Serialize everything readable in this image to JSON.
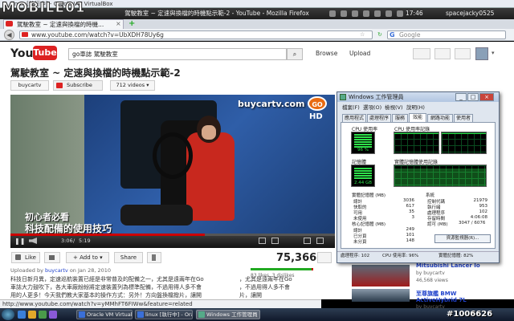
{
  "vm": {
    "title": "linux [執行中] - Oracle VM VirtualBox",
    "logo": "MOBILE01"
  },
  "panel": {
    "firefox_title": "駕駛教室 ~ 定速與換檔的時機點示範-2 - YouTube - Mozilla Firefox",
    "clock": "17:46",
    "user": "spacejacky0525"
  },
  "browser": {
    "tab_label": "駕駛教室 ~ 定速與換檔的時機...",
    "new_tab": "+",
    "url": "www.youtube.com/watch?v=UbXDH78Uy6g",
    "search_placeholder": "Google",
    "status_url": "http://www.youtube.com/watch?v=yMMhFT6FIWw&feature=related"
  },
  "youtube": {
    "logo_you": "You",
    "logo_tube": "Tube",
    "search_value": "go車誌 駕駛教室",
    "browse": "Browse",
    "upload": "Upload",
    "video_title": "駕駛教室 ~ 定速與換檔的時機點示範-2",
    "channel": "buycartv",
    "subscribe": "Subscribe",
    "videos": "712 videos ▾",
    "overlay_brand": "buycartv.com",
    "overlay_badge": "GO",
    "overlay_hd": "HD",
    "subtitle_line1": "初心者必看",
    "subtitle_line2": "科技配備的使用技巧",
    "progress": 0.6,
    "time_current": "3:06",
    "time_total": "5:19",
    "like": "Like",
    "add_to": "+ Add to ▾",
    "share": "Share",
    "views": "75,366",
    "likes_text": "83 likes, 3 dislikes",
    "like_ratio": 0.97,
    "uploaded_prefix": "Uploaded by",
    "uploaded_channel": "buycartv",
    "uploaded_date": "on Jan 28, 2010",
    "desc_line1": "科技日新月異，定速巡航裝置已經是非常普及的配備之一，尤其是遠兩年在Go",
    "desc_line2": "車誌大力鼓吹下，各大車廠紛紛將定速裝置列為標準配備，不過用得人多不會",
    "desc_line3": "用的人更多！今天我們教大家基本的操作方式：另外！方向盤換檔撥片，讓開",
    "desc_right1": "，尤其是遠兩年在Go",
    "desc_right2": "，不過用得人多不會",
    "desc_right3": "片，讓開"
  },
  "related": [
    {
      "title": "Mitsubishi Lancer Io",
      "by": "by buycartv",
      "views": "46,568 views"
    },
    {
      "title_a": "至尊旗艦 BMW",
      "title_b": "ActiveHybrid 7L",
      "by": "by buycartv"
    }
  ],
  "taskbar": {
    "items": [
      "Oracle VM Virtual...",
      "linux [執行中] - Ora...",
      "Windows 工作管理員"
    ],
    "watermark": "#1006626"
  },
  "taskmgr": {
    "title": "Windows 工作管理員",
    "menus": [
      "檔案(F)",
      "選項(O)",
      "檢視(V)",
      "說明(H)"
    ],
    "tabs": [
      "應用程式",
      "處理程序",
      "服務",
      "效能",
      "網路功能",
      "使用者"
    ],
    "cpu_usage_label": "CPU 使用率",
    "cpu_history_label": "CPU 使用率記錄",
    "cpu_usage_value": "96 %",
    "cpu_usage": 0.96,
    "mem_label": "記憶體",
    "mem_history_label": "實體記憶體使用記錄",
    "mem_value": "2.44 GB",
    "physical_title": "實體記憶體 (MB)",
    "physical": [
      {
        "k": "總計",
        "v": "3036"
      },
      {
        "k": "快取的",
        "v": "617"
      },
      {
        "k": "可用",
        "v": "35"
      },
      {
        "k": "未使用",
        "v": "3"
      }
    ],
    "system_title": "系統",
    "system": [
      {
        "k": "控制代碼",
        "v": "21979"
      },
      {
        "k": "執行緒",
        "v": "953"
      },
      {
        "k": "處理程序",
        "v": "102"
      },
      {
        "k": "存留時間",
        "v": "4:06:08"
      },
      {
        "k": "認可 (MB)",
        "v": "3047 / 6076"
      }
    ],
    "kernel_title": "核心記憶體 (MB)",
    "kernel": [
      {
        "k": "總計",
        "v": "249"
      },
      {
        "k": "已分頁",
        "v": "101"
      },
      {
        "k": "未分頁",
        "v": "148"
      }
    ],
    "resmon_btn": "資源監視器(R)...",
    "status_processes": "處理程序: 102",
    "status_cpu": "CPU 使用率: 96%",
    "status_mem": "實體記憶體: 82%"
  }
}
